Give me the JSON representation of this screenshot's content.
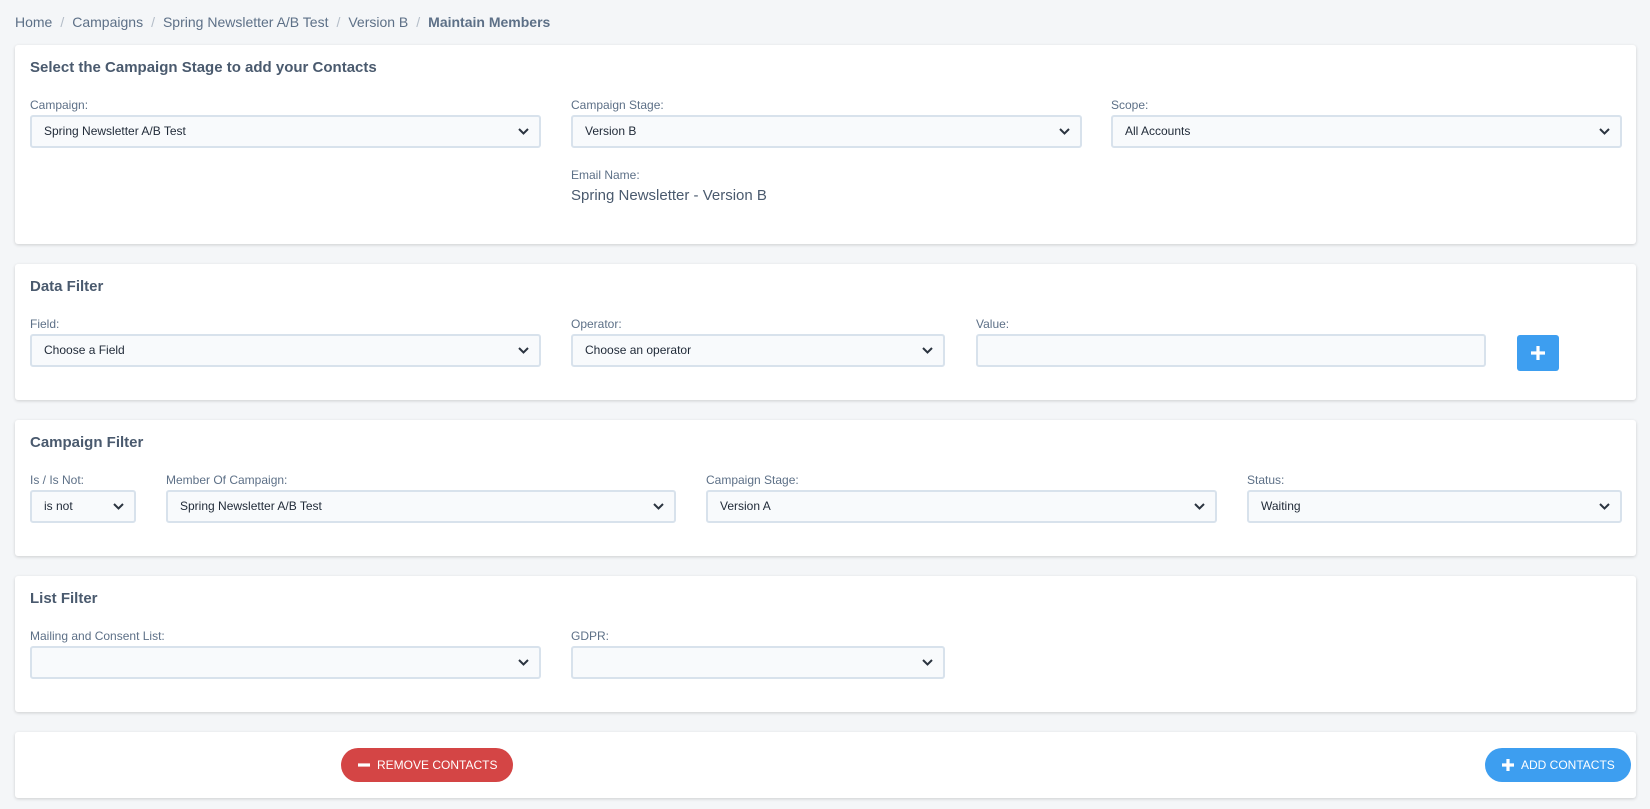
{
  "breadcrumb": {
    "items": [
      "Home",
      "Campaigns",
      "Spring Newsletter A/B Test",
      "Version B"
    ],
    "current": "Maintain Members"
  },
  "stage_card": {
    "title": "Select the Campaign Stage to add your Contacts",
    "campaign_label": "Campaign:",
    "campaign_value": "Spring Newsletter A/B Test",
    "stage_label": "Campaign Stage:",
    "stage_value": "Version B",
    "scope_label": "Scope:",
    "scope_value": "All Accounts",
    "email_name_label": "Email Name:",
    "email_name_value": "Spring Newsletter - Version B"
  },
  "data_filter": {
    "title": "Data Filter",
    "field_label": "Field:",
    "field_value": "Choose a Field",
    "operator_label": "Operator:",
    "operator_value": "Choose an operator",
    "value_label": "Value:",
    "value_value": ""
  },
  "campaign_filter": {
    "title": "Campaign Filter",
    "is_label": "Is / Is Not:",
    "is_value": "is not",
    "member_label": "Member Of Campaign:",
    "member_value": "Spring Newsletter A/B Test",
    "stage_label": "Campaign Stage:",
    "stage_value": "Version A",
    "status_label": "Status:",
    "status_value": "Waiting"
  },
  "list_filter": {
    "title": "List Filter",
    "mailing_label": "Mailing and Consent List:",
    "mailing_value": "",
    "gdpr_label": "GDPR:",
    "gdpr_value": ""
  },
  "actions": {
    "remove_label": "Remove Contacts",
    "add_label": "Add Contacts"
  },
  "colors": {
    "remove": "#d44545",
    "add": "#3d9ef0"
  },
  "icons": {
    "chevron": "chevron-down-icon",
    "plus": "plus-icon",
    "minus": "minus-icon"
  }
}
